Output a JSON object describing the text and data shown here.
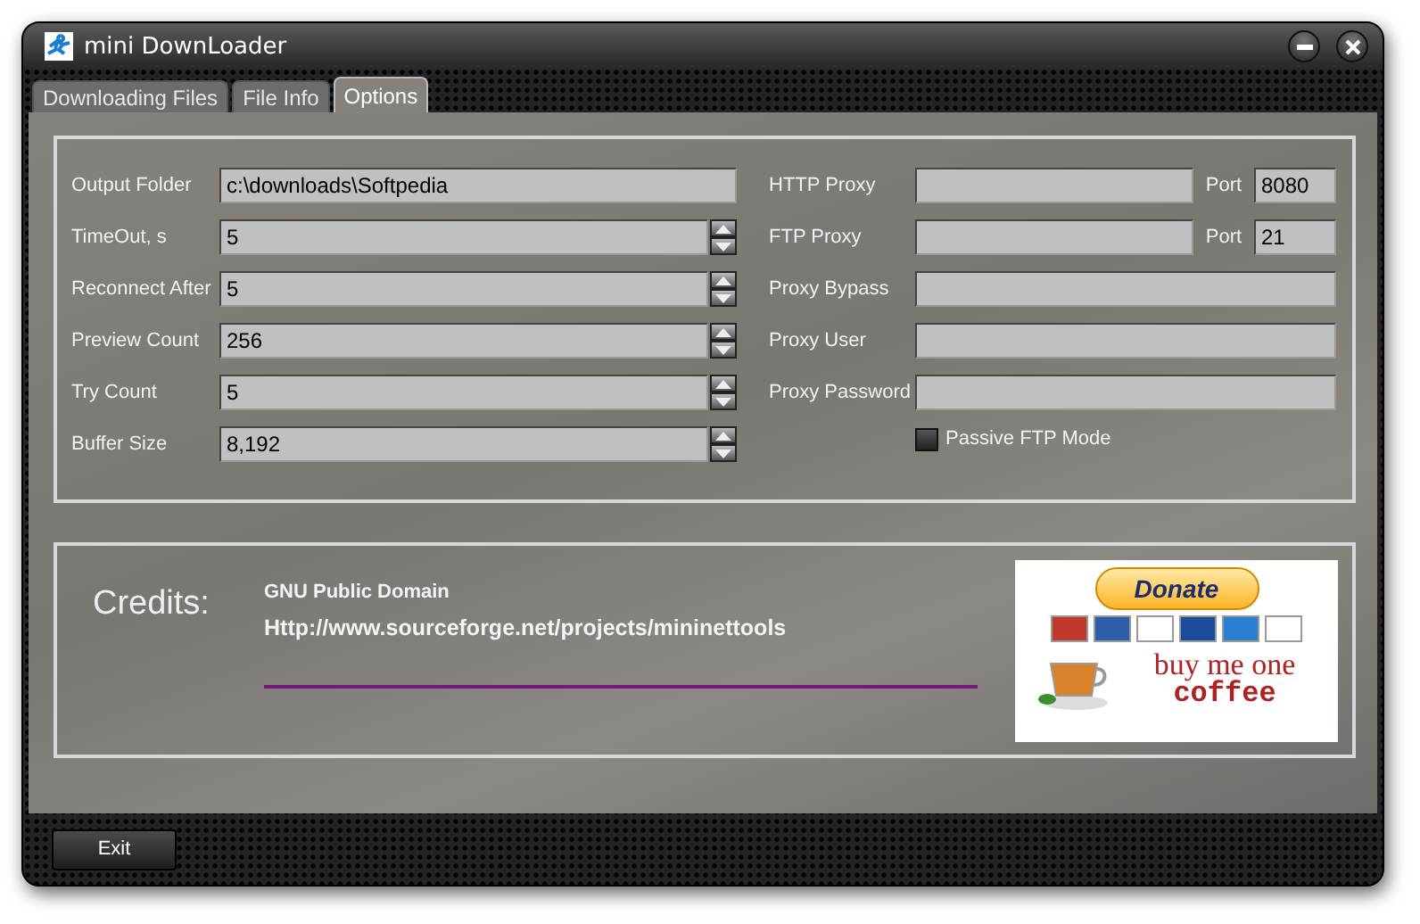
{
  "window": {
    "title": "mini DownLoader"
  },
  "tabs": [
    {
      "label": "Downloading Files",
      "selected": false
    },
    {
      "label": "File Info",
      "selected": false
    },
    {
      "label": "Options",
      "selected": true
    }
  ],
  "options": {
    "left_fields": [
      {
        "label": "Output Folder",
        "value": "c:\\downloads\\Softpedia",
        "kind": "text"
      },
      {
        "label": "TimeOut, s",
        "value": "5",
        "kind": "spinner"
      },
      {
        "label": "Reconnect After",
        "value": "5",
        "kind": "spinner"
      },
      {
        "label": "Preview Count",
        "value": "256",
        "kind": "spinner"
      },
      {
        "label": "Try Count",
        "value": "5",
        "kind": "spinner"
      },
      {
        "label": "Buffer Size",
        "value": "8,192",
        "kind": "spinner"
      }
    ],
    "right_fields": [
      {
        "label": "HTTP Proxy",
        "kind": "with_port",
        "port_label": "Port",
        "port_value": "8080"
      },
      {
        "label": "FTP Proxy",
        "kind": "with_port",
        "port_label": "Port",
        "port_value": "21"
      },
      {
        "label": "Proxy Bypass",
        "kind": "text"
      },
      {
        "label": "Proxy User",
        "kind": "text"
      },
      {
        "label": "Proxy Password",
        "kind": "text"
      }
    ],
    "passive_ftp": {
      "label": "Passive FTP Mode",
      "checked": false
    }
  },
  "credits": {
    "heading": "Credits:",
    "license": "GNU Public Domain",
    "url": "Http://www.sourceforge.net/projects/mininettools",
    "donate": {
      "button": "Donate",
      "slogan_line_1": "buy me one",
      "slogan_line_2": "coffee"
    }
  },
  "buttons": [
    {
      "label": "Exit"
    }
  ]
}
